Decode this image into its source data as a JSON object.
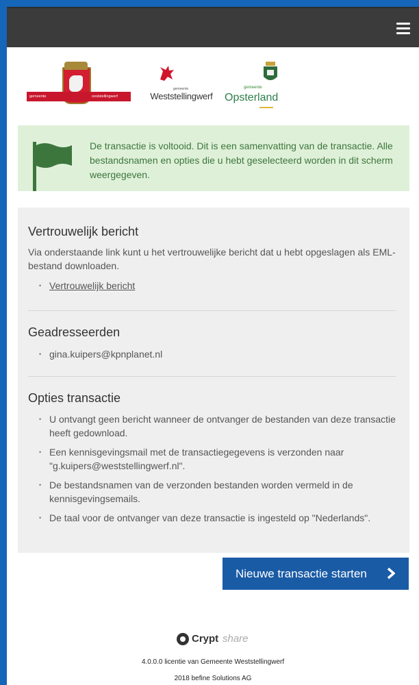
{
  "logos": {
    "oost": {
      "left": "gemeente",
      "right": "ooststellingwerf"
    },
    "west": {
      "small": "gemeente",
      "big": "Weststellingwerf"
    },
    "opst": {
      "small": "gemeente",
      "big": "Opsterland"
    }
  },
  "alert": {
    "message": "De transactie is voltooid. Dit is een samenvatting van de transactie. Alle bestandsnamen en opties die u hebt geselecteerd worden in dit scherm weergegeven."
  },
  "sections": {
    "message": {
      "title": "Vertrouwelijk bericht",
      "description": "Via onderstaande link kunt u het vertrouwelijke bericht dat u hebt opgeslagen als EML-bestand downloaden.",
      "link": "Vertrouwelijk bericht"
    },
    "recipients": {
      "title": "Geadresseerden",
      "items": [
        "gina.kuipers@kpnplanet.nl"
      ]
    },
    "options": {
      "title": "Opties transactie",
      "items": [
        "U ontvangt geen bericht wanneer de ontvanger de bestanden van deze transactie heeft gedownload.",
        "Een kennisgevingsmail met de transactiegegevens is verzonden naar \"g.kuipers@weststellingwerf.nl\".",
        "De bestandsnamen van de verzonden bestanden worden vermeld in de kennisgevingsemails.",
        "De taal voor de ontvanger van deze transactie is ingesteld op \"Nederlands\"."
      ]
    }
  },
  "actions": {
    "new_transaction": "Nieuwe transactie starten"
  },
  "footer": {
    "brand_bold": "Crypt",
    "brand_light": "share",
    "license": "4.0.0.0 licentie van Gemeente Weststellingwerf",
    "copyright": "2018 befine Solutions AG"
  },
  "colors": {
    "topbar": "#3b3b3b",
    "alert_bg": "#dff0d8",
    "alert_text": "#3c763d",
    "button": "#1a5ba6",
    "frame_border": "#1565b8"
  }
}
